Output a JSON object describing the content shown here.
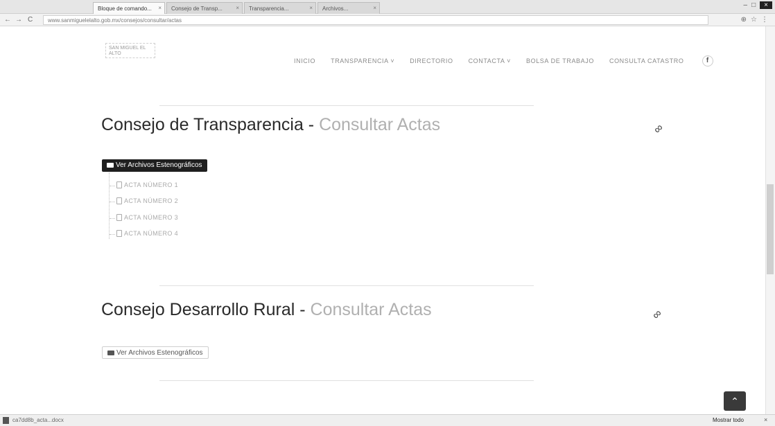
{
  "browser": {
    "tabs": [
      {
        "title": "Bloque de comando...",
        "active": true
      },
      {
        "title": "Consejo de Transp...",
        "active": false
      },
      {
        "title": "Transparencia...",
        "active": false
      },
      {
        "title": "Archivos...",
        "active": false
      }
    ],
    "url": "www.sanmiguelelalto.gob.mx/consejos/consultar/actas",
    "nav": {
      "back": "←",
      "forward": "→",
      "reload": "C"
    }
  },
  "site": {
    "logo_text": "SAN MIGUEL EL ALTO",
    "nav": [
      "INICIO",
      "TRANSPARENCIA ˅",
      "DIRECTORIO",
      "CONTACTA ˅",
      "BOLSA DE TRABAJO",
      "CONSULTA CATASTRO"
    ],
    "facebook": "f"
  },
  "sections": [
    {
      "title_main": "Consejo de Transparencia - ",
      "title_light": "Consultar Actas",
      "link_icon": "link-icon",
      "folder_label": "Ver Archivos Estenográficos",
      "items": [
        "ACTA NÚMERO 1",
        "ACTA NÚMERO 2",
        "ACTA NÚMERO 3",
        "ACTA NÚMERO 4"
      ]
    },
    {
      "title_main": "Consejo Desarrollo Rural - ",
      "title_light": "Consultar Actas",
      "link_icon": "link-icon",
      "folder_label": "Ver Archivos Estenográficos",
      "items": []
    }
  ],
  "downloads": {
    "file": "ca7dd8b_acta...docx",
    "show_all": "Mostrar todo",
    "close": "×"
  },
  "scroll_top_icon": "chevron-up-icon"
}
